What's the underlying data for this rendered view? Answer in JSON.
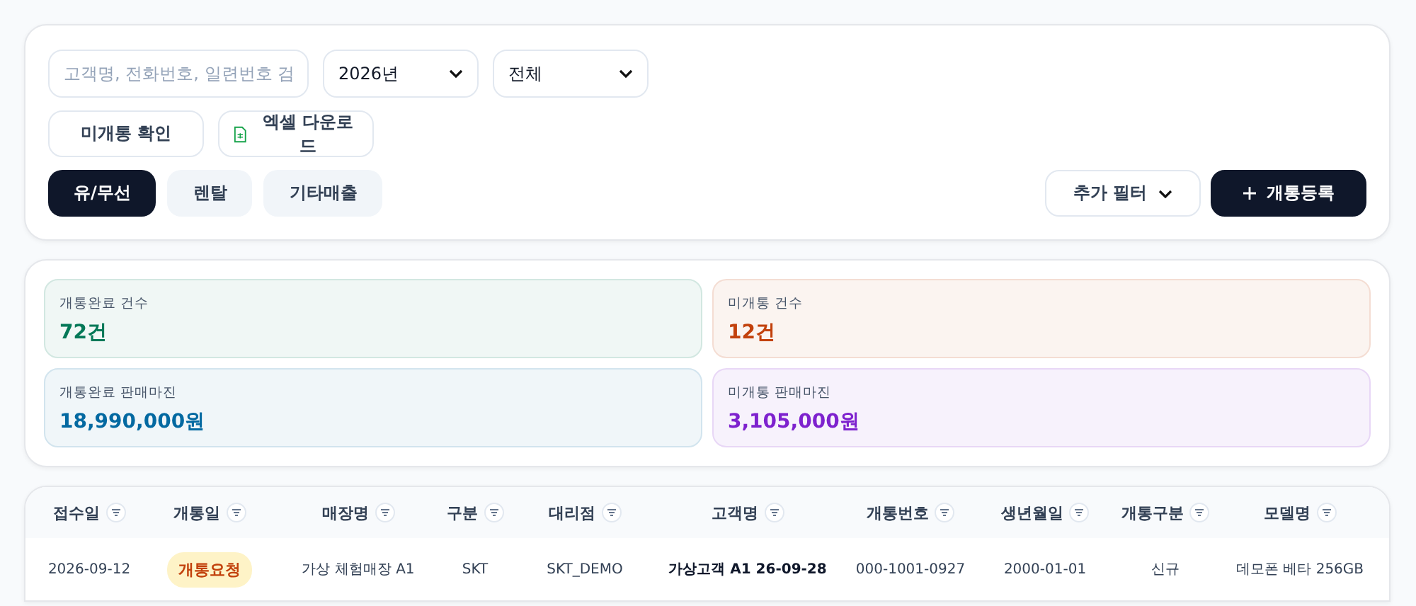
{
  "filters": {
    "search": {
      "placeholder": "고객명, 전화번호, 일련번호 검"
    },
    "year_select": {
      "value": "2026년"
    },
    "type_select": {
      "value": "전체"
    }
  },
  "actions": [
    {
      "label": "미개통 확인",
      "kind": "plain"
    },
    {
      "label": "엑셀 다운로드",
      "kind": "excel"
    }
  ],
  "tabs": [
    {
      "label": "유/무선",
      "selected": true
    },
    {
      "label": "렌탈",
      "selected": false
    },
    {
      "label": "기타매출",
      "selected": false
    }
  ],
  "more_filters": {
    "label": "추가 필터"
  },
  "register_button": {
    "label": "개통등록"
  },
  "stats": [
    {
      "label": "개통완료 건수",
      "value": "72건",
      "color": "#047857"
    },
    {
      "label": "미개통 건수",
      "value": "12건",
      "color": "#c2410c"
    },
    {
      "label": "개통완료 판매마진",
      "value": "18,990,000원",
      "color": "#0369a1"
    },
    {
      "label": "미개통 판매마진",
      "value": "3,105,000원",
      "color": "#7e22ce"
    }
  ],
  "table": {
    "columns": [
      "접수일",
      "개통일",
      "매장명",
      "구분",
      "대리점",
      "고객명",
      "개통번호",
      "생년월일",
      "개통구분",
      "모델명"
    ],
    "rows": [
      {
        "cells": [
          {
            "text": "2026-09-12",
            "kind": "text"
          },
          {
            "text": "개통요청",
            "kind": "badge"
          },
          {
            "text": "가상 체험매장 A1",
            "kind": "text"
          },
          {
            "text": "SKT",
            "kind": "text"
          },
          {
            "text": "SKT_DEMO",
            "kind": "text"
          },
          {
            "text": "가상고객 A1 26-09-28",
            "kind": "bold"
          },
          {
            "text": "000-1001-0927",
            "kind": "text"
          },
          {
            "text": "2000-01-01",
            "kind": "text"
          },
          {
            "text": "신규",
            "kind": "text"
          },
          {
            "text": "데모폰 베타 256GB",
            "kind": "text"
          }
        ]
      }
    ]
  }
}
